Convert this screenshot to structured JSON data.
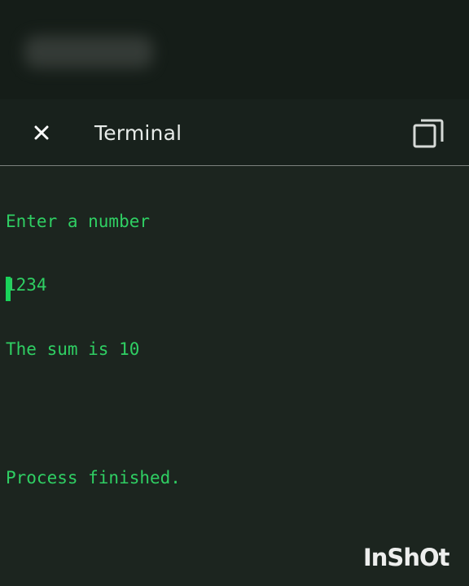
{
  "header": {
    "title": "Terminal",
    "close_icon": "close-icon",
    "copy_icon": "copy-icon"
  },
  "terminal": {
    "lines": [
      "Enter a number",
      "1234",
      "The sum is 10",
      "",
      "Process finished."
    ],
    "text_color": "#2fcf63",
    "cursor_color": "#19d35a",
    "background": "#1c251f"
  },
  "watermark": {
    "text": "InShOt"
  }
}
